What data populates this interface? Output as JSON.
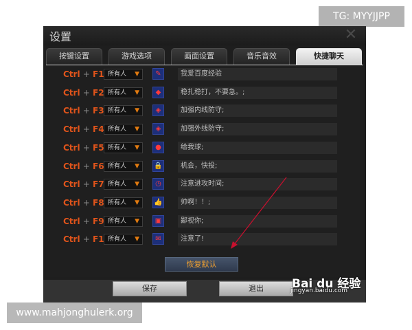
{
  "watermark_top": "TG: MYYJJPP",
  "watermark_bottom": "www.mahjonghulerk.org",
  "window": {
    "title": "设置"
  },
  "tabs": [
    {
      "label": "按键设置",
      "active": false
    },
    {
      "label": "游戏选项",
      "active": false
    },
    {
      "label": "画面设置",
      "active": false
    },
    {
      "label": "音乐音效",
      "active": false
    },
    {
      "label": "快捷聊天",
      "active": true
    }
  ],
  "shortcut_prefix": "Ctrl",
  "shortcut_plus": "+",
  "rows": [
    {
      "key": "F1",
      "target": "所有人",
      "icon": "pencil-icon",
      "message": "我爱百度经验"
    },
    {
      "key": "F2",
      "target": "所有人",
      "icon": "steady-icon",
      "message": "稳扎稳打，不要急。;"
    },
    {
      "key": "F3",
      "target": "所有人",
      "icon": "shield-icon",
      "message": "加强内线防守;"
    },
    {
      "key": "F4",
      "target": "所有人",
      "icon": "shield-icon",
      "message": "加强外线防守;"
    },
    {
      "key": "F5",
      "target": "所有人",
      "icon": "ball-icon",
      "message": "给我球;"
    },
    {
      "key": "F6",
      "target": "所有人",
      "icon": "lock-icon",
      "message": "机会，快投;"
    },
    {
      "key": "F7",
      "target": "所有人",
      "icon": "clock-icon",
      "message": "注意进攻时间;"
    },
    {
      "key": "F8",
      "target": "所有人",
      "icon": "thumbs-up-icon",
      "message": "帅啊！！;"
    },
    {
      "key": "F9",
      "target": "所有人",
      "icon": "screen-icon",
      "message": "鄙视你;"
    },
    {
      "key": "F10",
      "target": "所有人",
      "icon": "chat-icon",
      "message": "注意了!"
    }
  ],
  "buttons": {
    "restore_default": "恢复默认",
    "save": "保存",
    "exit": "退出"
  },
  "baidu": {
    "logo": "Bai du 经验",
    "url": "jingyan.baidu.com"
  },
  "colors": {
    "key_text": "#e0541b",
    "restore_text": "#f0a030",
    "arrow": "#c8102e"
  }
}
